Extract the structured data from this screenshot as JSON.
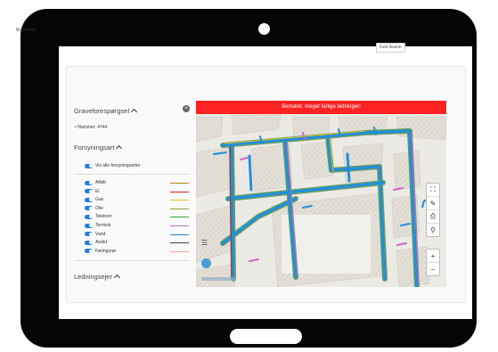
{
  "app": {
    "title": "Kortviser",
    "toolbar_button": "Fold Skærm"
  },
  "panel": {
    "section1": {
      "title": "Graveforespørgsel",
      "number_text": "• Nummer: 4744"
    },
    "section2": {
      "title": "Forsyningsart",
      "toggle_all_label": "Vis alle forsyningsarter"
    },
    "legend": [
      {
        "label": "Afløb",
        "color": "#b8860b"
      },
      {
        "label": "El",
        "color": "#cc2222"
      },
      {
        "label": "Gas",
        "color": "#e6c21a"
      },
      {
        "label": "Olie",
        "color": "#999933"
      },
      {
        "label": "Telekom",
        "color": "#33aa33"
      },
      {
        "label": "Termisk",
        "color": "#cc66cc"
      },
      {
        "label": "Vand",
        "color": "#2288cc"
      },
      {
        "label": "Andet",
        "color": "#444444"
      },
      {
        "label": "Føringsrør",
        "color": "#f4a0a0"
      }
    ],
    "section3": {
      "title": "Ledningsejer"
    }
  },
  "map": {
    "banner_text": "Bemærk: meget farlige ledninger!",
    "controls": {
      "fullscreen_icon": "fullscreen-icon",
      "measure_icon": "ruler-icon",
      "print_icon": "print-icon",
      "locate_icon": "location-pin-icon",
      "zoom_in": "+",
      "zoom_out": "−"
    }
  }
}
